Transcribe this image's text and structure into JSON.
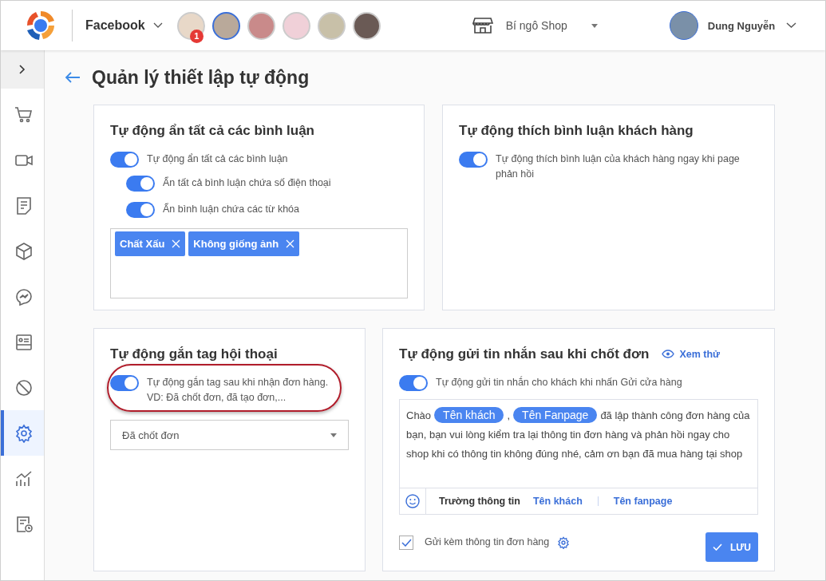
{
  "header": {
    "channel": "Facebook",
    "pages": [
      {
        "selected": false,
        "badge": "1"
      },
      {
        "selected": true
      },
      {
        "selected": false
      },
      {
        "selected": false
      },
      {
        "selected": false
      },
      {
        "selected": false
      }
    ],
    "shop": "Bí ngô Shop",
    "user": "Dung Nguyễn"
  },
  "sidebar": {
    "items": [
      {
        "kind": "cart",
        "selected": false
      },
      {
        "kind": "video",
        "selected": false
      },
      {
        "kind": "note",
        "selected": false
      },
      {
        "kind": "box",
        "selected": false
      },
      {
        "kind": "messenger",
        "selected": false
      },
      {
        "kind": "card",
        "selected": false
      },
      {
        "kind": "ban",
        "selected": false
      },
      {
        "kind": "gear",
        "selected": true
      },
      {
        "kind": "chart",
        "selected": false
      },
      {
        "kind": "report",
        "selected": false
      }
    ]
  },
  "page_title": "Quản lý thiết lập tự động",
  "hide_comments": {
    "title": "Tự động ẩn tất cả các bình luận",
    "options": [
      {
        "label": "Tự động ẩn tất cả các bình luận",
        "on": true,
        "nested": false
      },
      {
        "label": "Ẩn tất cả bình luận chứa số điện thoại",
        "on": true,
        "nested": true
      },
      {
        "label": "Ẩn bình luận chứa các từ khóa",
        "on": true,
        "nested": true
      }
    ],
    "keywords": [
      "Chất Xấu",
      "Không giống ảnh"
    ]
  },
  "like_comments": {
    "title": "Tự động thích bình luận khách hàng",
    "option": {
      "label": "Tự động thích bình luận của khách hàng ngay khi page phản hồi",
      "on": true
    }
  },
  "auto_tag": {
    "title": "Tự động gắn tag hội thoại",
    "option": {
      "label": "Tự động gắn tag sau khi nhận đơn hàng.",
      "hint": "VD: Đã chốt đơn, đã tạo đơn,...",
      "on": true,
      "highlighted": true
    },
    "tag_select": "Đã chốt đơn"
  },
  "auto_message": {
    "title": "Tự động gửi tin nhắn sau khi chốt đơn",
    "preview_link": "Xem thử",
    "option": {
      "label": "Tự động gửi tin nhắn cho khách khi nhấn Gửi cửa hàng",
      "on": true
    },
    "message": [
      {
        "kind": "text",
        "text": "Chào"
      },
      {
        "kind": "chip",
        "text": "Tên khách"
      },
      {
        "kind": "text",
        "text": ","
      },
      {
        "kind": "chip",
        "text": "Tên Fanpage"
      },
      {
        "kind": "text",
        "text": "đã lập thành công đơn hàng của bạn, bạn vui lòng kiểm tra lại thông tin đơn hàng và phản hồi ngay cho shop khi có thông tin không đúng nhé, cảm ơn bạn đã mua hàng tại shop"
      }
    ],
    "fields_label": "Trường thông tin",
    "fields": [
      "Tên khách",
      "Tên fanpage"
    ],
    "attach": {
      "label": "Gửi kèm thông tin đơn hàng",
      "checked": true
    },
    "save": "LƯU"
  }
}
